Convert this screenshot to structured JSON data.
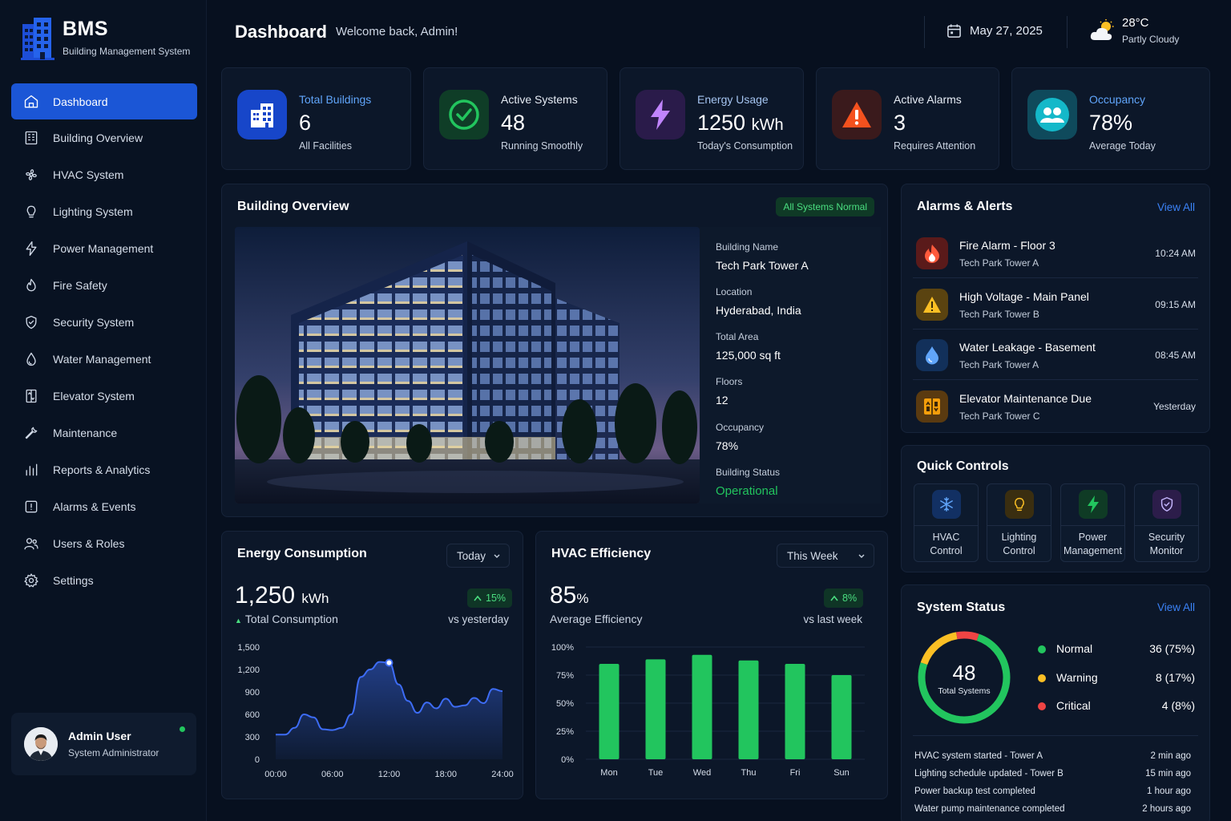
{
  "brand": {
    "title": "BMS",
    "subtitle": "Building Management System"
  },
  "sidebar": {
    "items": [
      {
        "label": "Dashboard",
        "icon": "home-icon",
        "active": true
      },
      {
        "label": "Building Overview",
        "icon": "building-icon"
      },
      {
        "label": "HVAC System",
        "icon": "fan-icon"
      },
      {
        "label": "Lighting System",
        "icon": "bulb-icon"
      },
      {
        "label": "Power Management",
        "icon": "bolt-icon"
      },
      {
        "label": "Fire Safety",
        "icon": "flame-icon"
      },
      {
        "label": "Security System",
        "icon": "shield-icon"
      },
      {
        "label": "Water Management",
        "icon": "droplet-icon"
      },
      {
        "label": "Elevator System",
        "icon": "elevator-icon"
      },
      {
        "label": "Maintenance",
        "icon": "wrench-icon"
      },
      {
        "label": "Reports & Analytics",
        "icon": "bar-chart-icon"
      },
      {
        "label": "Alarms & Events",
        "icon": "alarm-icon"
      },
      {
        "label": "Users & Roles",
        "icon": "users-icon"
      },
      {
        "label": "Settings",
        "icon": "gear-icon"
      }
    ]
  },
  "user": {
    "name": "Admin User",
    "role": "System Administrator"
  },
  "header": {
    "title": "Dashboard",
    "welcome": "Welcome back, Admin!",
    "date": "May 27, 2025",
    "weather_temp": "28°C",
    "weather_desc": "Partly Cloudy"
  },
  "stats": [
    {
      "title": "Total Buildings",
      "value": "6",
      "unit": "",
      "sub": "All Facilities",
      "icon": "buildings-icon",
      "title_color": "#60a5fa",
      "icon_bg": "#1746c9"
    },
    {
      "title": "Active Systems",
      "value": "48",
      "unit": "",
      "sub": "Running Smoothly",
      "icon": "check-circle-icon",
      "title_color": "#e6ecf5",
      "icon_bg": "#0f3d27"
    },
    {
      "title": "Energy Usage",
      "value": "1250",
      "unit": "kWh",
      "sub": "Today's Consumption",
      "icon": "bolt-icon",
      "title_color": "#a5c4f0",
      "icon_bg": "#2a1b4a"
    },
    {
      "title": "Active Alarms",
      "value": "3",
      "unit": "",
      "sub": "Requires Attention",
      "icon": "warning-icon",
      "title_color": "#e6ecf5",
      "icon_bg": "#3a1a1c"
    },
    {
      "title": "Occupancy",
      "value": "78%",
      "unit": "",
      "sub": "Average Today",
      "icon": "users-icon",
      "title_color": "#60a5fa",
      "icon_bg": "#0f4a5c"
    }
  ],
  "building_overview": {
    "title": "Building Overview",
    "badge": "All Systems Normal",
    "details": [
      {
        "label": "Building Name",
        "value": "Tech Park Tower A"
      },
      {
        "label": "Location",
        "value": "Hyderabad, India"
      },
      {
        "label": "Total Area",
        "value": "125,000 sq ft"
      },
      {
        "label": "Floors",
        "value": "12"
      },
      {
        "label": "Occupancy",
        "value": "78%"
      },
      {
        "label": "Building Status",
        "value": "Operational"
      }
    ]
  },
  "alarms": {
    "title": "Alarms & Alerts",
    "view_all": "View All",
    "items": [
      {
        "title": "Fire Alarm - Floor 3",
        "location": "Tech Park Tower A",
        "time": "10:24 AM",
        "icon": "flame-icon"
      },
      {
        "title": "High Voltage - Main Panel",
        "location": "Tech Park Tower B",
        "time": "09:15 AM",
        "icon": "warning-icon"
      },
      {
        "title": "Water Leakage - Basement",
        "location": "Tech Park Tower A",
        "time": "08:45 AM",
        "icon": "droplet-icon"
      },
      {
        "title": "Elevator Maintenance Due",
        "location": "Tech Park Tower C",
        "time": "Yesterday",
        "icon": "elevator-icon"
      }
    ]
  },
  "quick_controls": {
    "title": "Quick Controls",
    "items": [
      {
        "line1": "HVAC",
        "line2": "Control",
        "icon": "snowflake-icon"
      },
      {
        "line1": "Lighting",
        "line2": "Control",
        "icon": "bulb-icon"
      },
      {
        "line1": "Power",
        "line2": "Management",
        "icon": "bolt-icon"
      },
      {
        "line1": "Security",
        "line2": "Monitor",
        "icon": "shield-icon"
      }
    ]
  },
  "system_status": {
    "title": "System Status",
    "view_all": "View All",
    "total": "48",
    "total_label": "Total Systems",
    "legend": [
      {
        "name": "Normal",
        "value": "36 (75%)",
        "color": "#22c55e",
        "fraction": 0.75
      },
      {
        "name": "Warning",
        "value": "8 (17%)",
        "color": "#fbbf24",
        "fraction": 0.17
      },
      {
        "name": "Critical",
        "value": "4 (8%)",
        "color": "#ef4444",
        "fraction": 0.08
      }
    ],
    "log": [
      {
        "text": "HVAC system started - Tower A",
        "time": "2 min ago"
      },
      {
        "text": "Lighting schedule updated - Tower B",
        "time": "15 min ago"
      },
      {
        "text": "Power backup test completed",
        "time": "1 hour ago"
      },
      {
        "text": "Water pump maintenance completed",
        "time": "2 hours ago"
      }
    ]
  },
  "energy": {
    "title": "Energy Consumption",
    "range": "Today",
    "value": "1,250",
    "unit": "kWh",
    "label": "Total Consumption",
    "delta": "15%",
    "vs": "vs yesterday"
  },
  "hvac": {
    "title": "HVAC Efficiency",
    "range": "This Week",
    "value": "85",
    "unit": "%",
    "label": "Average Efficiency",
    "delta": "8%",
    "vs": "vs last week"
  },
  "chart_data": [
    {
      "type": "area",
      "title": "Energy Consumption",
      "x": [
        "00:00",
        "01:00",
        "02:00",
        "03:00",
        "04:00",
        "05:00",
        "06:00",
        "07:00",
        "08:00",
        "09:00",
        "10:00",
        "11:00",
        "12:00",
        "13:00",
        "14:00",
        "15:00",
        "16:00",
        "17:00",
        "18:00",
        "19:00",
        "20:00",
        "21:00",
        "22:00",
        "23:00",
        "24:00"
      ],
      "x_ticks": [
        "00:00",
        "06:00",
        "12:00",
        "18:00",
        "24:00"
      ],
      "y_ticks": [
        "1,500",
        "1,200",
        "900",
        "600",
        "300",
        "0"
      ],
      "ylim": [
        0,
        1500
      ],
      "values": [
        330,
        330,
        420,
        600,
        560,
        400,
        390,
        420,
        600,
        1100,
        1200,
        1300,
        1290,
        1000,
        780,
        620,
        760,
        680,
        810,
        700,
        720,
        820,
        750,
        940,
        910
      ],
      "highlight_index": 12,
      "color": "#3b6cf6"
    },
    {
      "type": "bar",
      "title": "HVAC Efficiency",
      "categories": [
        "Mon",
        "Tue",
        "Wed",
        "Thu",
        "Fri",
        "Sun"
      ],
      "values": [
        85,
        89,
        93,
        88,
        85,
        75
      ],
      "y_ticks": [
        "100%",
        "75%",
        "50%",
        "25%",
        "0%"
      ],
      "ylim": [
        0,
        100
      ],
      "color": "#22c55e"
    }
  ]
}
